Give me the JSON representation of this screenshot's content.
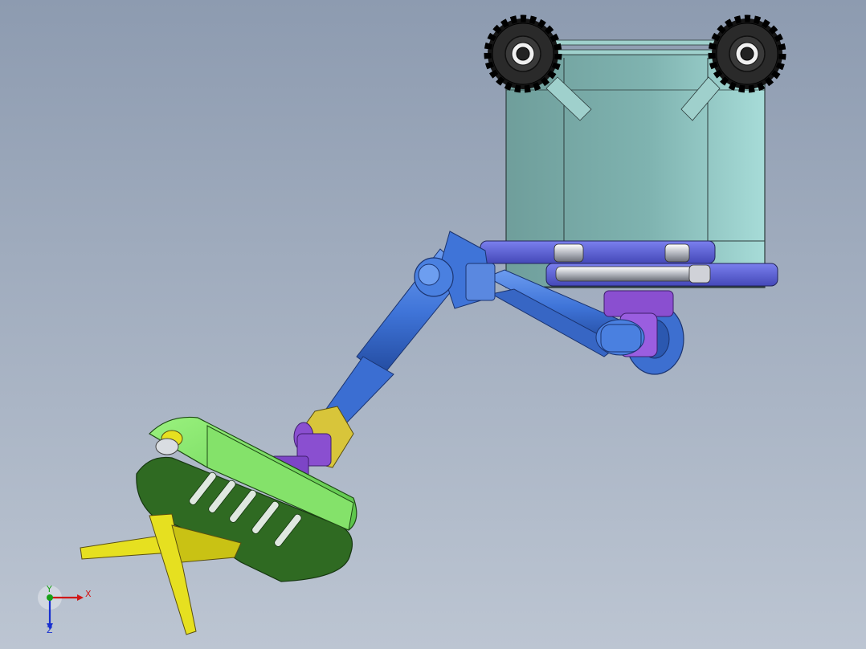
{
  "viewport": {
    "background_top": "#8d9bb0",
    "background_bottom": "#bcc5d2"
  },
  "model": {
    "parts": [
      {
        "name": "chassis-box",
        "color": "#7fb3b0"
      },
      {
        "name": "sprocket-wheel-left",
        "color": "#1a1a1a"
      },
      {
        "name": "sprocket-wheel-right",
        "color": "#1a1a1a"
      },
      {
        "name": "link-plates",
        "color": "#5a5fd6"
      },
      {
        "name": "arm-links",
        "color": "#3f74d8"
      },
      {
        "name": "pivot-brackets",
        "color": "#8a4fd0"
      },
      {
        "name": "clevis-joint",
        "color": "#d8c53a"
      },
      {
        "name": "shovel-body",
        "color": "#7fe06a"
      },
      {
        "name": "shovel-blades",
        "color": "#e6e020"
      }
    ]
  },
  "triad": {
    "x_label": "X",
    "y_label": "Y",
    "z_label": "Z",
    "x_color": "#d01818",
    "y_color": "#18a018",
    "z_color": "#1830d0"
  }
}
